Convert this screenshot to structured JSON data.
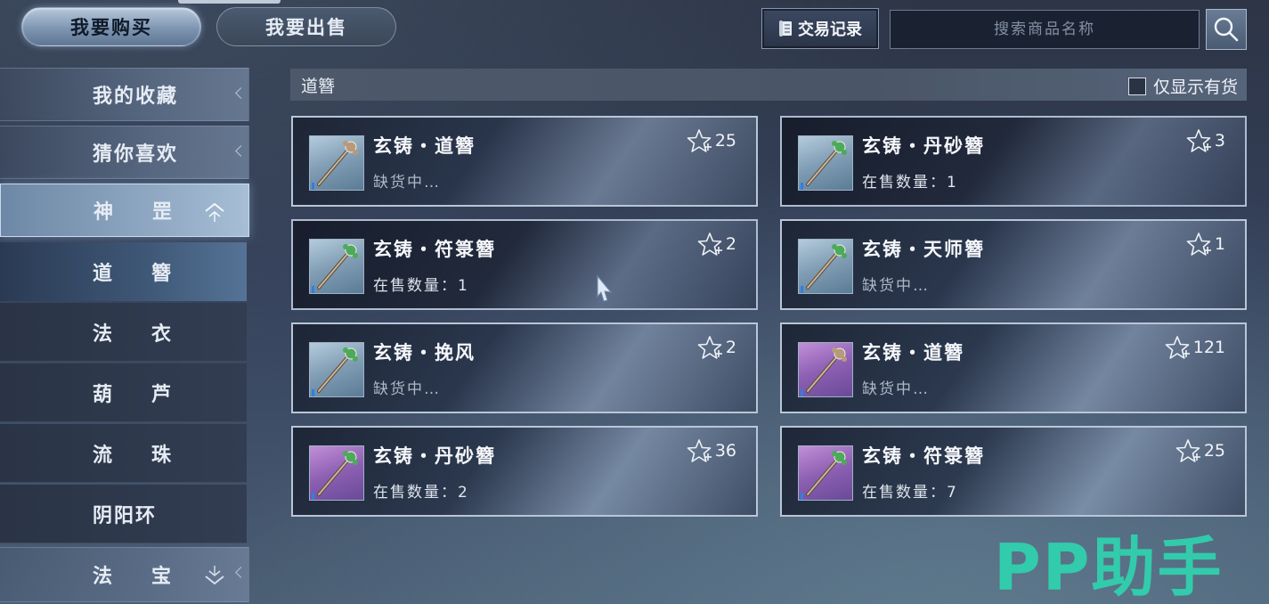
{
  "top_tabs": {
    "buy": "我要购买",
    "sell": "我要出售"
  },
  "toolbar": {
    "record_label": "交易记录",
    "search_placeholder": "搜索商品名称"
  },
  "sidebar": {
    "items": [
      {
        "label": "我的收藏",
        "type": "category"
      },
      {
        "label": "猜你喜欢",
        "type": "category"
      },
      {
        "label": "神罡",
        "type": "category-open"
      },
      {
        "label": "道簪",
        "type": "sub-selected"
      },
      {
        "label": "法衣",
        "type": "sub"
      },
      {
        "label": "葫芦",
        "type": "sub"
      },
      {
        "label": "流珠",
        "type": "sub"
      },
      {
        "label": "阴阳环",
        "type": "sub"
      },
      {
        "label": "法宝",
        "type": "category-more"
      }
    ]
  },
  "main": {
    "category_title": "道簪",
    "stock_filter_label": "仅显示有货",
    "stock_filter_checked": false,
    "items": [
      {
        "name": "玄铸・道簪",
        "status": "缺货中…",
        "in_stock": false,
        "favorites": "25",
        "rarity": "blue"
      },
      {
        "name": "玄铸・丹砂簪",
        "status": "在售数量：1",
        "in_stock": true,
        "favorites": "3",
        "rarity": "blue"
      },
      {
        "name": "玄铸・符箓簪",
        "status": "在售数量：1",
        "in_stock": true,
        "favorites": "2",
        "rarity": "blue"
      },
      {
        "name": "玄铸・天师簪",
        "status": "缺货中…",
        "in_stock": false,
        "favorites": "1",
        "rarity": "blue"
      },
      {
        "name": "玄铸・挽风",
        "status": "缺货中…",
        "in_stock": false,
        "favorites": "2",
        "rarity": "blue"
      },
      {
        "name": "玄铸・道簪",
        "status": "缺货中…",
        "in_stock": false,
        "favorites": "121",
        "rarity": "purple"
      },
      {
        "name": "玄铸・丹砂簪",
        "status": "在售数量：2",
        "in_stock": true,
        "favorites": "36",
        "rarity": "purple"
      },
      {
        "name": "玄铸・符箓簪",
        "status": "在售数量：7",
        "in_stock": true,
        "favorites": "25",
        "rarity": "purple"
      }
    ]
  },
  "watermark": "PP助手",
  "icons": {
    "search": "search-icon",
    "record": "scroll-icon",
    "favorite": "star-icon",
    "collapse": "chevron-up-icon",
    "expand": "chevron-down-icon"
  },
  "colors": {
    "accent": "#2fd3b0",
    "card_border": "#b9c6d8",
    "rarity_blue": "#7f9cb3",
    "rarity_purple": "#8c5fb2"
  }
}
